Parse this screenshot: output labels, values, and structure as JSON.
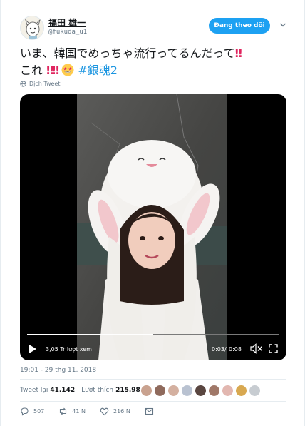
{
  "author": {
    "name": "福田 雄一",
    "handle": "@fukuda_u1",
    "follow_label": "Đang theo dõi"
  },
  "tweet": {
    "line1": "いま、韓国でめっちゃ流行ってるんだって",
    "line1_bang": "‼",
    "line2_prefix": "これ",
    "line2_bangs": "‼‼",
    "hashtag": "#銀魂2",
    "translate_label": "Dịch Tweet"
  },
  "video": {
    "views": "3,05 Tr lượt xem",
    "current_time": "0:03",
    "separator": "/",
    "total_time": "0:08",
    "progress": 0.5
  },
  "meta": {
    "timestamp": "19:01 - 29 thg 11, 2018"
  },
  "stats": {
    "retweets_label": "Tweet lại",
    "retweets_value": "41.142",
    "likes_label": "Lượt thích",
    "likes_value": "215.984",
    "liker_colors": [
      "#c9a28f",
      "#8f6a5c",
      "#d4b0a0",
      "#b9c2d1",
      "#5a4640",
      "#a07868",
      "#e2b7b0",
      "#d8a850",
      "#c7ccd1"
    ]
  },
  "actions": {
    "replies": "507",
    "retweets": "41 N",
    "likes": "216 N"
  },
  "colors": {
    "accent": "#1da1f2",
    "link": "#1b95e0",
    "alert": "#e0245e"
  }
}
